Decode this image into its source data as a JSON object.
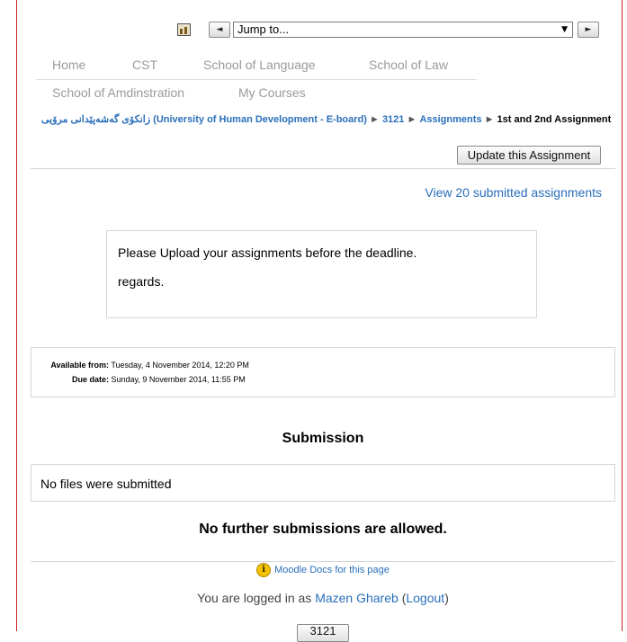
{
  "colors": {
    "link": "#2a6fba",
    "tab": "#9a9a9a",
    "border": "#d6d6d6",
    "frame": "#cc2222"
  },
  "jumpbar": {
    "icon": "page-icon",
    "prev_label": "◄",
    "next_label": "►",
    "select_value": "Jump to...",
    "select_caret": "▼"
  },
  "tabs": [
    "Home",
    "CST",
    "School of Language",
    "School of Law",
    "School of Amdinstration",
    "My Courses"
  ],
  "breadcrumb": {
    "root": "زانکۆی گەشەپێدانی مرۆیی (University of Human Development - E-board)",
    "course": "3121",
    "section": "Assignments",
    "current": "1st and 2nd Assignment",
    "separator": "►"
  },
  "update_button": "Update this Assignment",
  "view_submissions": "View 20 submitted assignments",
  "intro": {
    "line1": "Please Upload your assignments before the deadline.",
    "line2": "regards."
  },
  "dates": {
    "available_label": "Available from:",
    "available_value": "Tuesday, 4 November 2014, 12:20 PM",
    "due_label": "Due date:",
    "due_value": "Sunday, 9 November 2014, 11:55 PM"
  },
  "submission": {
    "heading": "Submission",
    "no_files": "No files were submitted",
    "no_more": "No further submissions are allowed."
  },
  "footer": {
    "docs_icon": "info-icon",
    "docs_link": "Moodle Docs for this page",
    "logged_prefix": "You are logged in as",
    "user": "Mazen Ghareb",
    "logout": "Logout",
    "course_button": "3121"
  }
}
